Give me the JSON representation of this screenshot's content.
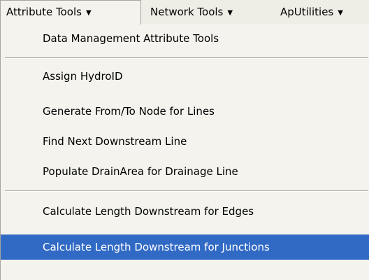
{
  "menubar": {
    "items": [
      {
        "label": "Attribute Tools",
        "arrow": "▼"
      },
      {
        "label": "Network Tools",
        "arrow": "▼"
      },
      {
        "label": "ApUtilities",
        "arrow": "▼"
      }
    ]
  },
  "dropdown": {
    "items": [
      {
        "label": "Data Management Attribute Tools"
      },
      {
        "label": "Assign HydroID"
      },
      {
        "label": "Generate From/To Node for Lines"
      },
      {
        "label": "Find Next Downstream Line"
      },
      {
        "label": "Populate DrainArea for Drainage Line"
      },
      {
        "label": "Calculate Length Downstream for Edges"
      },
      {
        "label": "Calculate Length Downstream for Junctions",
        "selected": true
      }
    ]
  },
  "colors": {
    "menu_background": "#f4f3ee",
    "highlight": "#316ac5",
    "highlight_text": "#ffffff"
  }
}
